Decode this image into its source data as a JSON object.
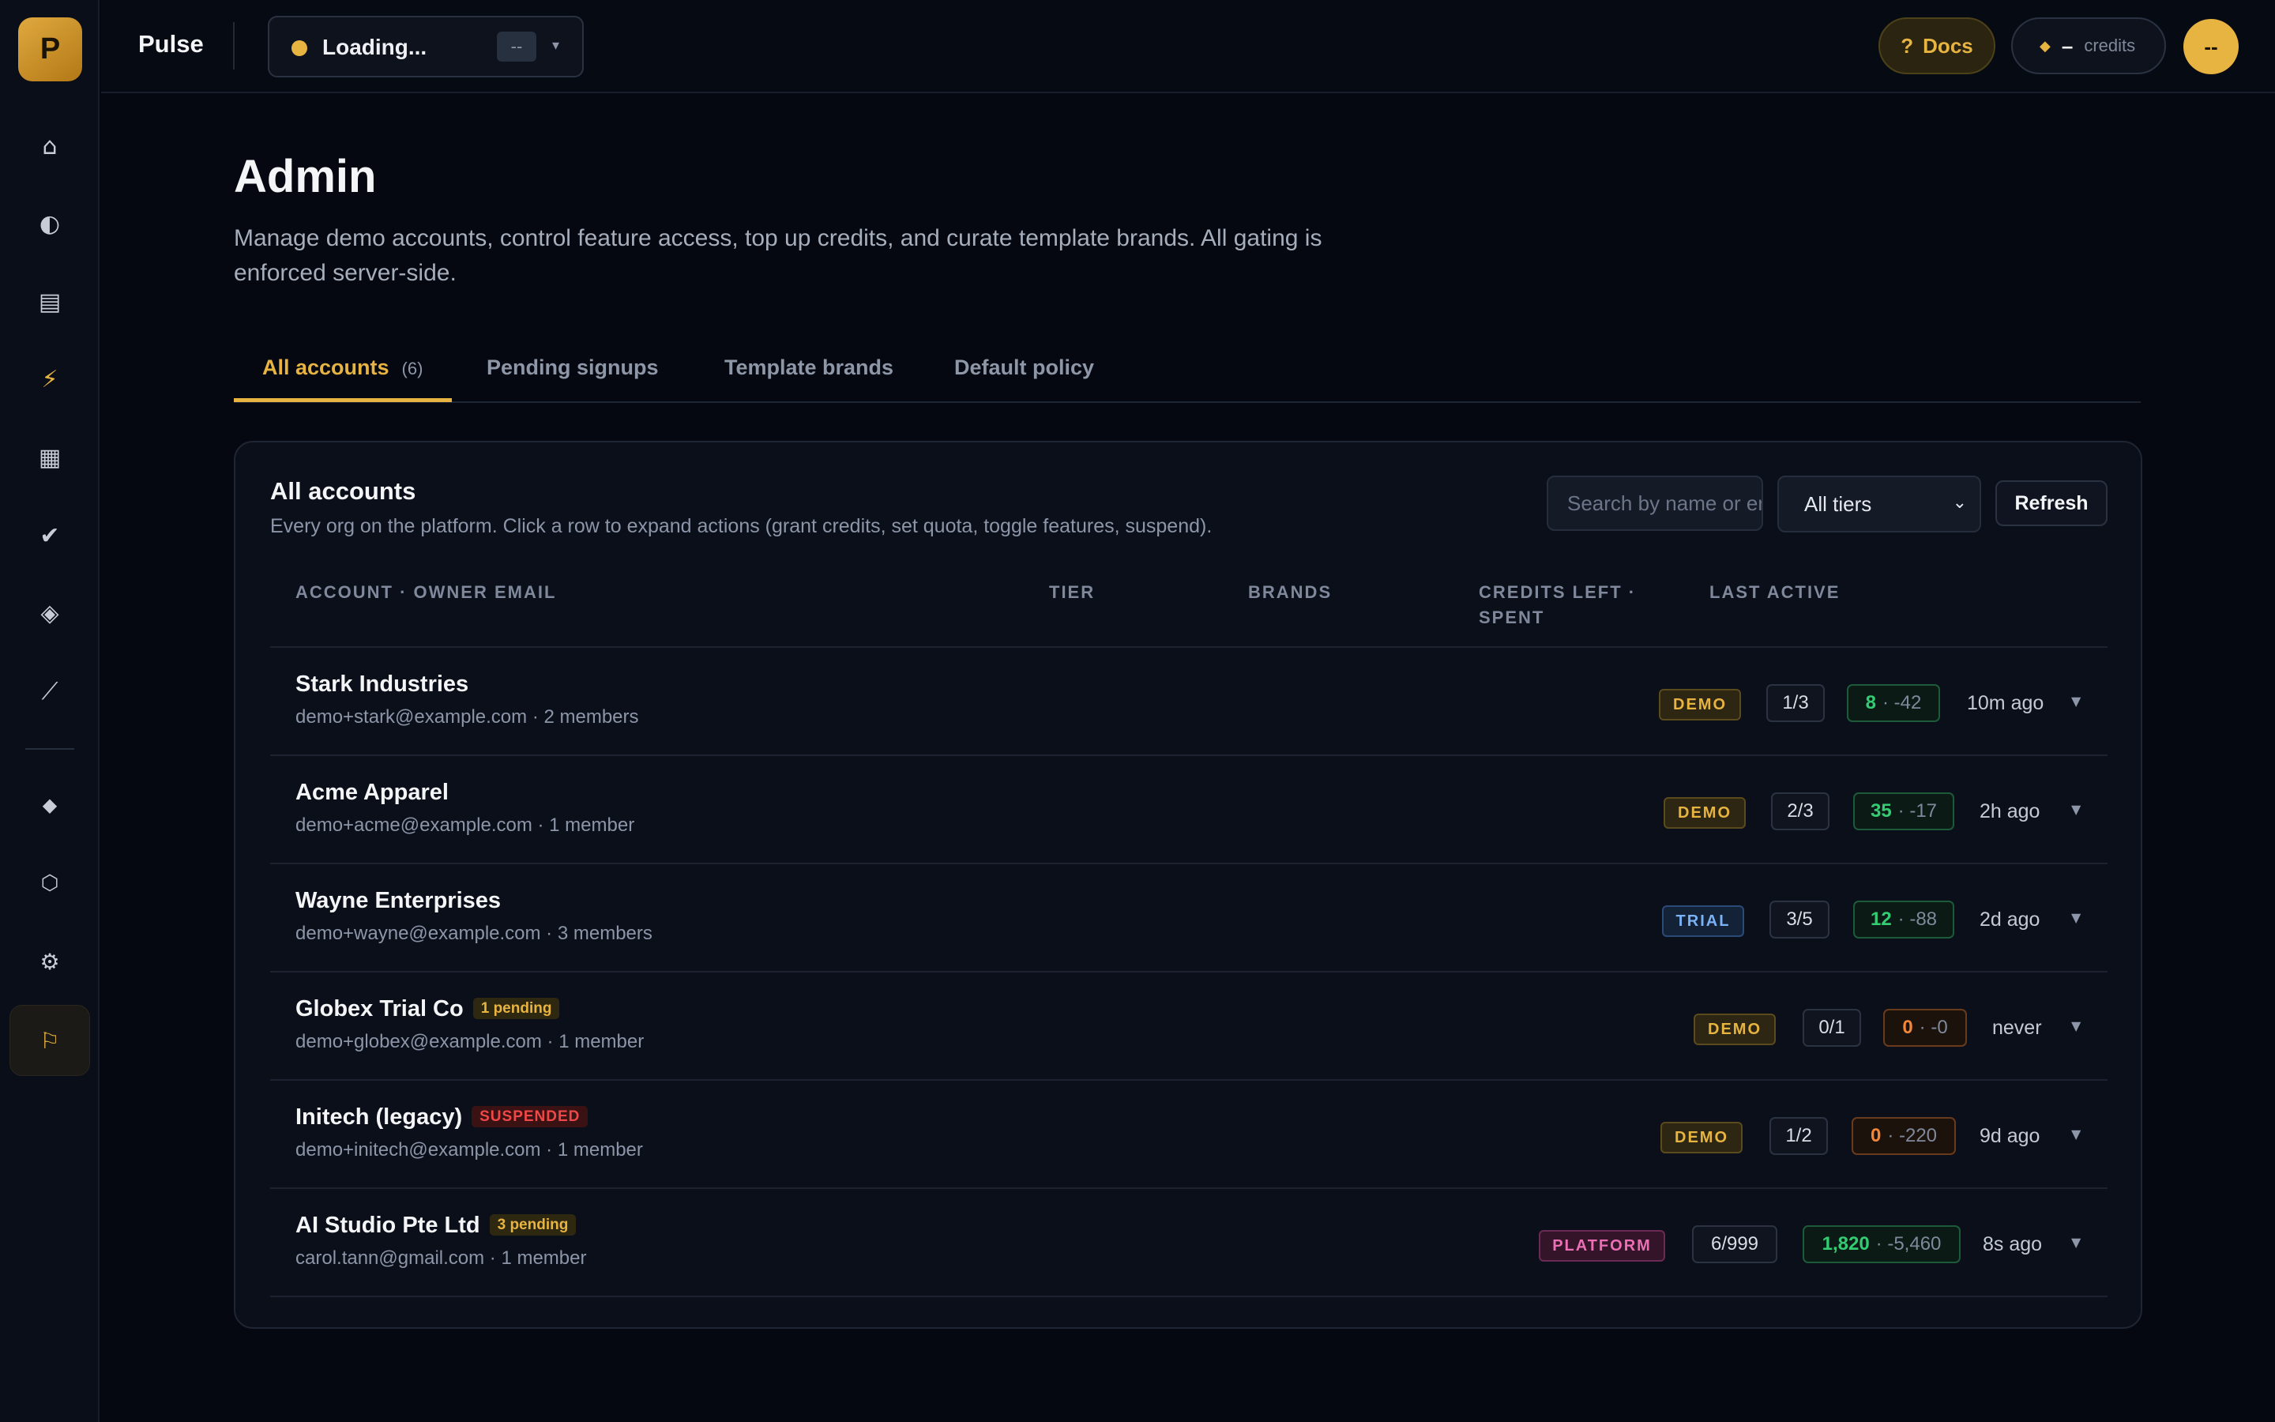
{
  "app": {
    "logo_letter": "P",
    "brand_name": "Pulse"
  },
  "sidebar": {
    "icons": [
      {
        "name": "home-icon",
        "glyph": "⌂"
      },
      {
        "name": "contrast-icon",
        "glyph": "◐"
      },
      {
        "name": "document-icon",
        "glyph": "▤"
      },
      {
        "name": "lightning-icon",
        "glyph": "⚡"
      },
      {
        "name": "grid-icon",
        "glyph": "▦"
      },
      {
        "name": "check-icon",
        "glyph": "✔"
      },
      {
        "name": "diamond-icon",
        "glyph": "◈"
      },
      {
        "name": "trend-icon",
        "glyph": "⟋"
      },
      {
        "name": "gem-icon",
        "glyph": "◆"
      },
      {
        "name": "hexagon-icon",
        "glyph": "⬡"
      },
      {
        "name": "gear-icon",
        "glyph": "⚙"
      },
      {
        "name": "flag-icon",
        "glyph": "⚐"
      }
    ]
  },
  "topbar": {
    "org_status": "Loading...",
    "org_chip": "--",
    "docs_label": "Docs",
    "docs_icon": "?",
    "credits_value": "–",
    "credits_label": "credits",
    "avatar_initials": "--"
  },
  "page": {
    "title": "Admin",
    "description": "Manage demo accounts, control feature access, top up credits, and curate template brands. All gating is enforced server-side."
  },
  "tabs": [
    {
      "label": "All accounts",
      "count": "(6)"
    },
    {
      "label": "Pending signups"
    },
    {
      "label": "Template brands"
    },
    {
      "label": "Default policy"
    }
  ],
  "panel": {
    "title": "All accounts",
    "description": "Every org on the platform. Click a row to expand actions (grant credits, set quota, toggle features, suspend).",
    "search_placeholder": "Search by name or email",
    "tier_filter": "All tiers",
    "refresh_label": "Refresh"
  },
  "table": {
    "headers": {
      "account": "ACCOUNT · OWNER EMAIL",
      "tier": "TIER",
      "brands": "BRANDS",
      "credits_line1": "CREDITS LEFT ·",
      "credits_line2": "SPENT",
      "last_active": "LAST ACTIVE"
    },
    "rows": [
      {
        "name": "Stark Industries",
        "flag": "",
        "sub": "demo+stark@example.com · 2 members",
        "tier": "DEMO",
        "brands": "1/3",
        "credits_left": "8",
        "credits_spent": "· -42",
        "last_active": "10m ago"
      },
      {
        "name": "Acme Apparel",
        "flag": "",
        "sub": "demo+acme@example.com · 1 member",
        "tier": "DEMO",
        "brands": "2/3",
        "credits_left": "35",
        "credits_spent": "· -17",
        "last_active": "2h ago"
      },
      {
        "name": "Wayne Enterprises",
        "flag": "",
        "sub": "demo+wayne@example.com · 3 members",
        "tier": "TRIAL",
        "brands": "3/5",
        "credits_left": "12",
        "credits_spent": "· -88",
        "last_active": "2d ago"
      },
      {
        "name": "Globex Trial Co",
        "flag": "1 pending",
        "sub": "demo+globex@example.com · 1 member",
        "tier": "DEMO",
        "brands": "0/1",
        "credits_left": "0",
        "credits_spent": "· -0",
        "last_active": "never"
      },
      {
        "name": "Initech (legacy)",
        "flag": "SUSPENDED",
        "sub": "demo+initech@example.com · 1 member",
        "tier": "DEMO",
        "brands": "1/2",
        "credits_left": "0",
        "credits_spent": "· -220",
        "last_active": "9d ago"
      },
      {
        "name": "AI Studio Pte Ltd",
        "flag": "3 pending",
        "sub": "carol.tann@gmail.com · 1 member",
        "tier": "PLATFORM",
        "brands": "6/999",
        "credits_left": "1,820",
        "credits_spent": "· -5,460",
        "last_active": "8s ago"
      }
    ]
  },
  "colors": {
    "accent": "#e7b341",
    "background": "#050810",
    "panel": "#0b0f1a",
    "credits_ok": "#33cc73",
    "credits_low": "#f2873a",
    "suspended": "#f04848",
    "trial": "#7ab2f5",
    "platform": "#ec6fb5"
  }
}
